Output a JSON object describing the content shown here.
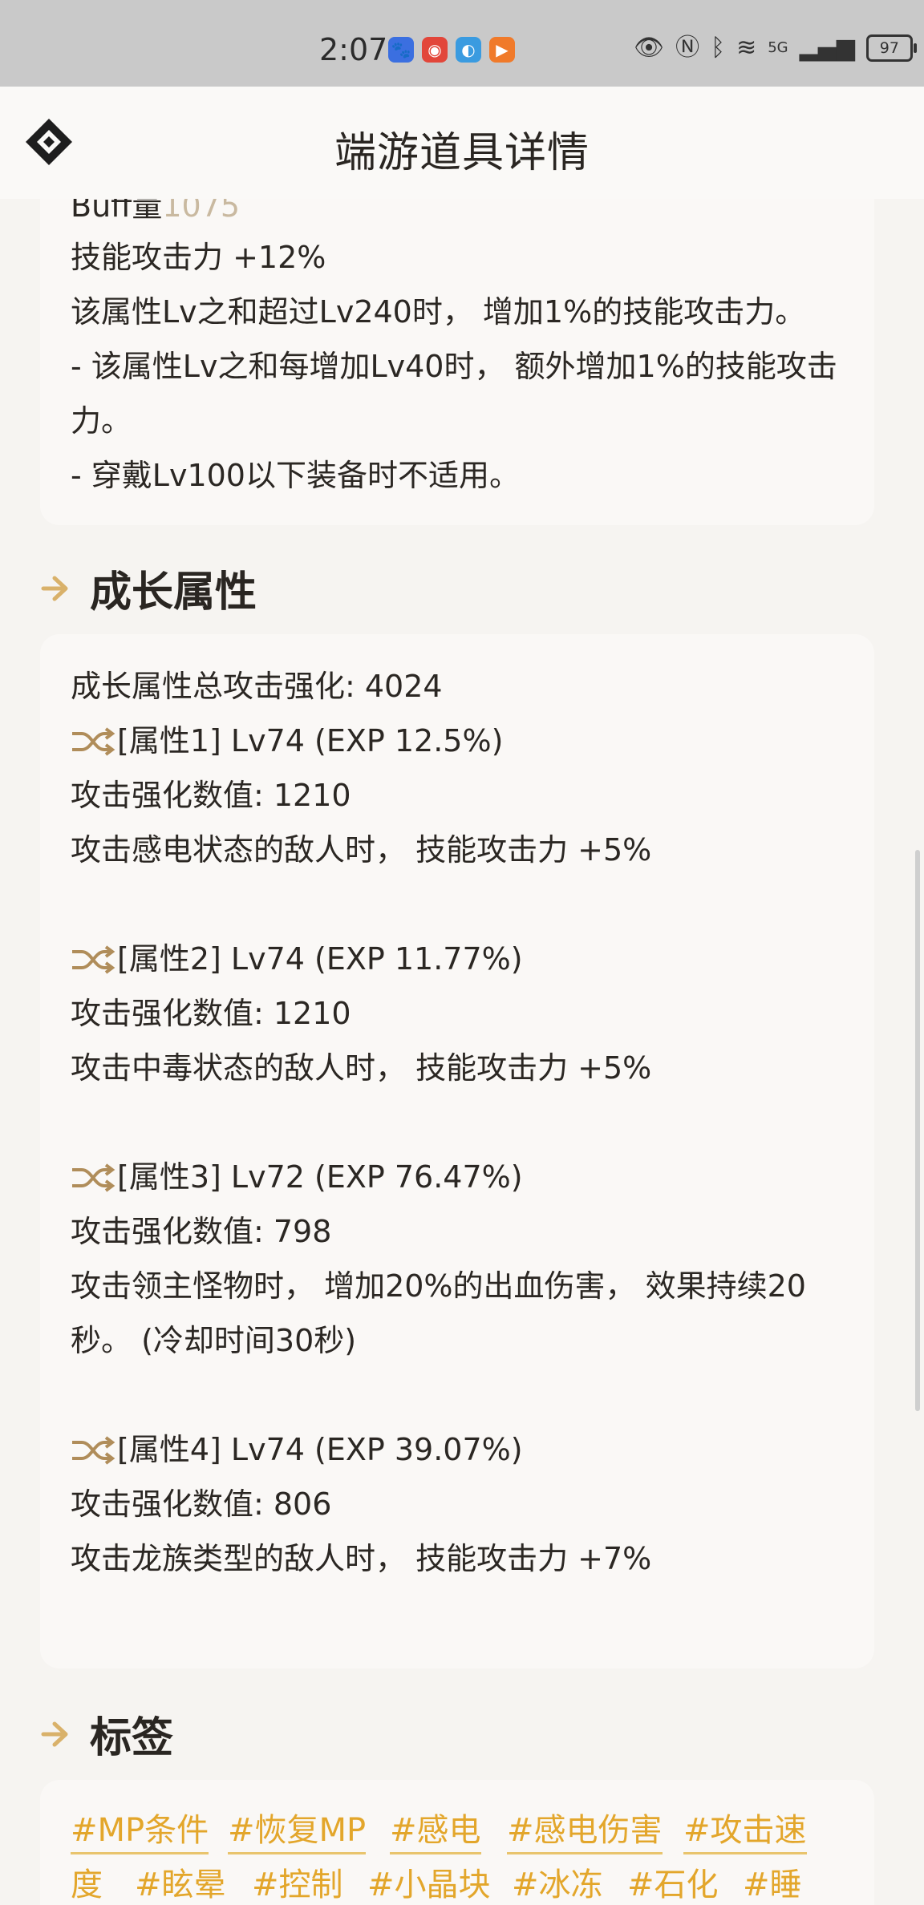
{
  "status_bar": {
    "time": "2:07",
    "battery": "97",
    "network": "5G"
  },
  "header": {
    "title": "端游道具详情"
  },
  "top_card": {
    "cut_line_label": "Buff量",
    "cut_line_value": "1075",
    "lines": [
      "技能攻击力 +12%",
      "该属性Lv之和超过Lv240时， 增加1%的技能攻击力。",
      "- 该属性Lv之和每增加Lv40时， 额外增加1%的技能攻击",
      "力。",
      "- 穿戴Lv100以下装备时不适用。"
    ]
  },
  "growth": {
    "section_title": "成长属性",
    "total": "成长属性总攻击强化: 4024",
    "attributes": [
      {
        "header": "[属性1] Lv74 (EXP 12.5%)",
        "value": "攻击强化数值:  1210",
        "effect": [
          "攻击感电状态的敌人时， 技能攻击力 +5%"
        ]
      },
      {
        "header": "[属性2] Lv74 (EXP 11.77%)",
        "value": "攻击强化数值:  1210",
        "effect": [
          "攻击中毒状态的敌人时， 技能攻击力 +5%"
        ]
      },
      {
        "header": "[属性3] Lv72 (EXP 76.47%)",
        "value": "攻击强化数值:  798",
        "effect": [
          "攻击领主怪物时， 增加20%的出血伤害， 效果持续20",
          "秒。 (冷却时间30秒)"
        ]
      },
      {
        "header": "[属性4] Lv74 (EXP 39.07%)",
        "value": "攻击强化数值:  806",
        "effect": [
          "攻击龙族类型的敌人时， 技能攻击力 +7%"
        ]
      }
    ]
  },
  "tags": {
    "section_title": "标签",
    "items": [
      "#MP条件",
      "#恢复MP",
      "#感电",
      "#感电伤害",
      "#攻击速",
      "度",
      "#眩晕",
      "#控制",
      "#小晶块",
      "#冰冻",
      "#石化",
      "#睡"
    ]
  },
  "colors": {
    "accent": "#e3a62b",
    "arrow": "#d9b16a",
    "background": "#f6f4f1",
    "card": "#faf8f6"
  }
}
